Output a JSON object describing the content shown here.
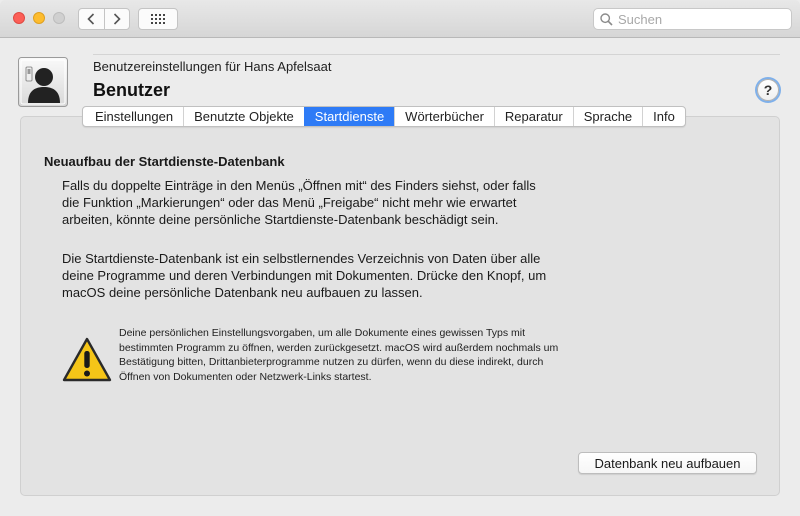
{
  "toolbar": {
    "search_placeholder": "Suchen"
  },
  "header": {
    "subtitle": "Benutzereinstellungen für Hans Apfelsaat",
    "title": "Benutzer",
    "help": "?"
  },
  "tabs": [
    {
      "label": "Einstellungen",
      "active": false
    },
    {
      "label": "Benutzte Objekte",
      "active": false
    },
    {
      "label": "Startdienste",
      "active": true
    },
    {
      "label": "Wörterbücher",
      "active": false
    },
    {
      "label": "Reparatur",
      "active": false
    },
    {
      "label": "Sprache",
      "active": false
    },
    {
      "label": "Info",
      "active": false
    }
  ],
  "content": {
    "heading": "Neuaufbau der Startdienste-Datenbank",
    "paragraph1": "Falls du doppelte Einträge in den Menüs „Öffnen mit“ des Finders siehst, oder falls die Funktion „Markierungen“ oder das Menü „Freigabe“ nicht mehr wie erwartet arbeiten, könnte deine persönliche Startdienste-Datenbank beschädigt sein.",
    "paragraph2": "Die Startdienste-Datenbank ist ein selbstlernendes Verzeichnis von Daten über alle deine Programme und deren Verbindungen mit Dokumenten. Drücke den Knopf, um macOS deine persönliche Datenbank neu aufbauen zu lassen.",
    "warning": "Deine persönlichen Einstellungsvorgaben, um alle Dokumente eines gewissen Typs mit bestimmten Programm zu öffnen, werden zurückgesetzt. macOS wird außerdem nochmals um Bestätigung bitten, Drittanbieterprogramme nutzen zu dürfen, wenn du diese indirekt, durch Öffnen von Dokumenten oder Netzwerk-Links startest.",
    "button": "Datenbank neu aufbauen"
  },
  "colors": {
    "accent": "#2e7bf6",
    "close": "#fc5f57",
    "minimize": "#fdbc2e",
    "warning_fill": "#f5c518"
  },
  "icons": [
    "chevron-left-icon",
    "chevron-right-icon",
    "grid-icon",
    "search-icon",
    "user-avatar-icon",
    "warning-icon"
  ]
}
